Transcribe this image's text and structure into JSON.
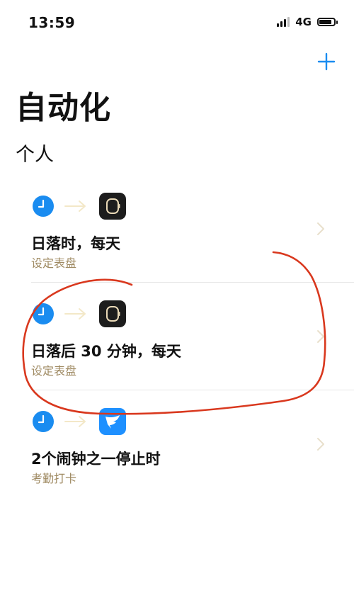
{
  "status_bar": {
    "time": "13:59",
    "network": "4G",
    "icons": [
      "signal-icon",
      "battery-icon"
    ]
  },
  "header": {
    "add_icon": "plus-icon",
    "title": "自动化"
  },
  "section": {
    "title": "个人"
  },
  "automations": [
    {
      "title": "日落时，每天",
      "subtitle": "设定表盘",
      "trigger_icon": "clock-icon",
      "action_icon": "watch-app-icon"
    },
    {
      "title": "日落后 30 分钟，每天",
      "subtitle": "设定表盘",
      "trigger_icon": "clock-icon",
      "action_icon": "watch-app-icon"
    },
    {
      "title": "2个闹钟之一停止时",
      "subtitle": "考勤打卡",
      "trigger_icon": "clock-icon",
      "action_icon": "dingtalk-app-icon"
    }
  ],
  "colors": {
    "accent": "#1a8cf0",
    "subtitle": "#9f8a62",
    "annotation": "#d9381e",
    "arrow": "#f3e8c8"
  }
}
